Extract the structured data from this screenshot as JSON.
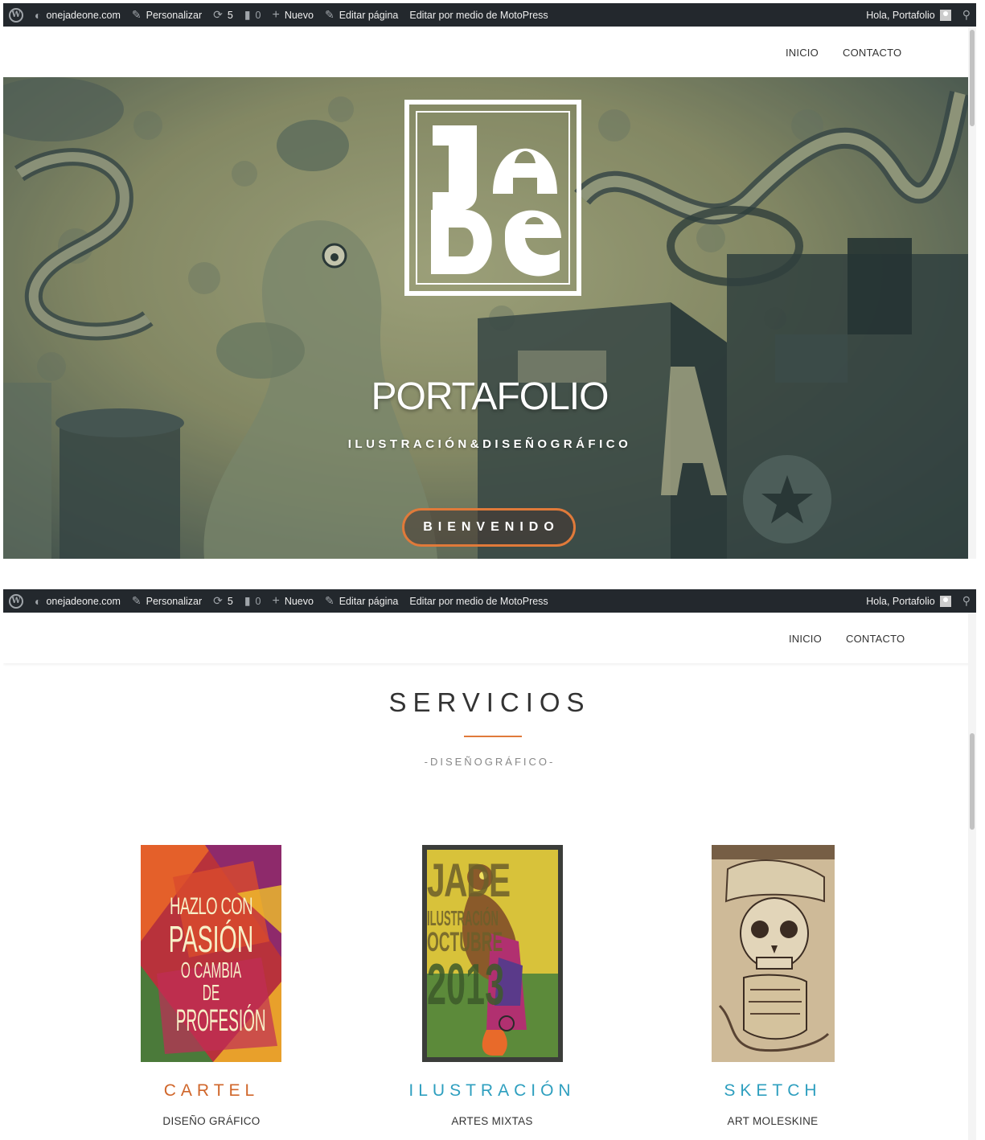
{
  "adminbar": {
    "site": "onejadeone.com",
    "customize": "Personalizar",
    "updates": "5",
    "comments": "0",
    "new": "Nuevo",
    "edit_page": "Editar página",
    "edit_motopress": "Editar por medio de MotoPress",
    "greeting": "Hola, Portafolio"
  },
  "nav": {
    "items": [
      "INICIO",
      "CONTACTO"
    ]
  },
  "hero": {
    "title": "PORTAFOLIO",
    "subtitle": "ILUSTRACIÓN&DISEÑOGRÁFICO",
    "button": "BIENVENIDO",
    "accent": "#e07a3a"
  },
  "services": {
    "title": "SERVICIOS",
    "subtitle": "-DISEÑOGRÁFICO-",
    "cards": [
      {
        "title": "CARTEL",
        "subtitle": "DISEÑO GRÁFICO",
        "color": "#d0662a",
        "poster_lines": [
          "HAZLO CON",
          "PASIÓN",
          "O CAMBIA DE",
          "PROFESIÓN"
        ]
      },
      {
        "title": "ILUSTRACIÓN",
        "subtitle": "ARTES MIXTAS",
        "color": "#2e9fbf",
        "poster_lines": [
          "JADE",
          "ILUSTRACIÓN",
          "OCTUBRE",
          "2013"
        ]
      },
      {
        "title": "SKETCH",
        "subtitle": "ART MOLESKINE",
        "color": "#2e9fbf"
      }
    ]
  }
}
